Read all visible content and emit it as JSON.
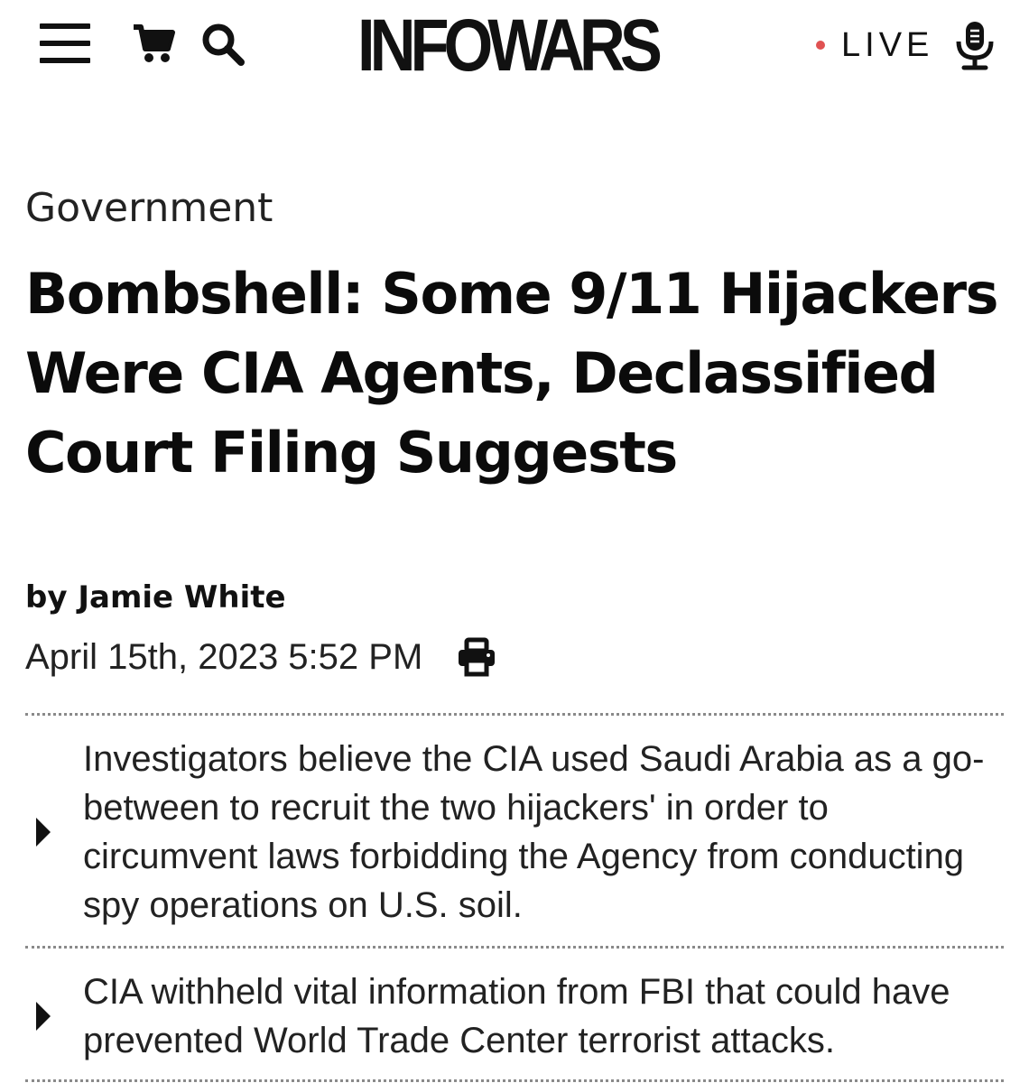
{
  "header": {
    "logo": "INFOWARS",
    "live_label": "LIVE",
    "colors": {
      "live_dot": "#e05252",
      "text": "#111111"
    },
    "icons": [
      "menu-icon",
      "cart-icon",
      "search-icon",
      "microphone-icon"
    ]
  },
  "article": {
    "category": "Government",
    "headline": "Bombshell: Some 9/11 Hijackers Were CIA Agents, Declassified Court Filing Suggests",
    "byline_prefix": "by",
    "author": "Jamie White",
    "date": "April 15th, 2023 5:52 PM",
    "bullets": [
      {
        "text": "Investigators believe the CIA used Saudi Arabia as a go-between to recruit the two hijackers' in order to circumvent laws forbidding the Agency from conducting spy operations on U.S. soil."
      },
      {
        "text": "CIA withheld vital information from FBI that could have prevented World Trade Center terrorist attacks."
      }
    ]
  }
}
